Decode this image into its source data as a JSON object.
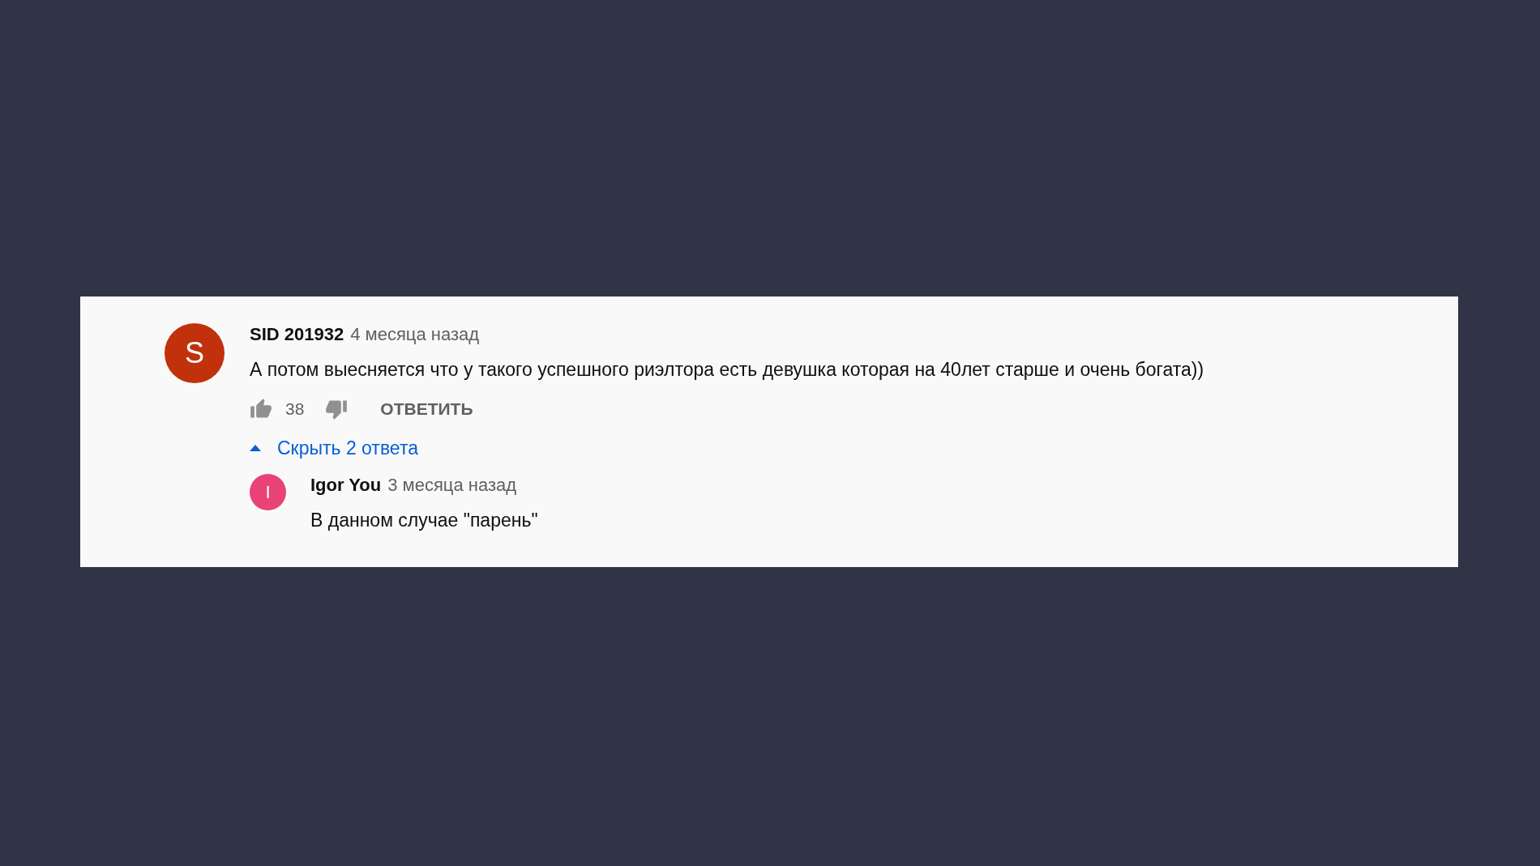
{
  "comment": {
    "avatar": {
      "letter": "S",
      "color": "#c1310c"
    },
    "author": "SID 201932",
    "time": "4 месяца назад",
    "text": "А потом выесняется что у такого успешного риэлтора есть девушка которая на 40лет старше и очень богата))",
    "likes": "38",
    "reply_button": "ОТВЕТИТЬ"
  },
  "replies_toggle": {
    "label": "Скрыть 2 ответа",
    "expanded": true
  },
  "replies": [
    {
      "avatar": {
        "letter": "I",
        "color": "#e94277"
      },
      "author": "Igor You",
      "time": "3 месяца назад",
      "text": "В данном случае \"парень\""
    }
  ]
}
